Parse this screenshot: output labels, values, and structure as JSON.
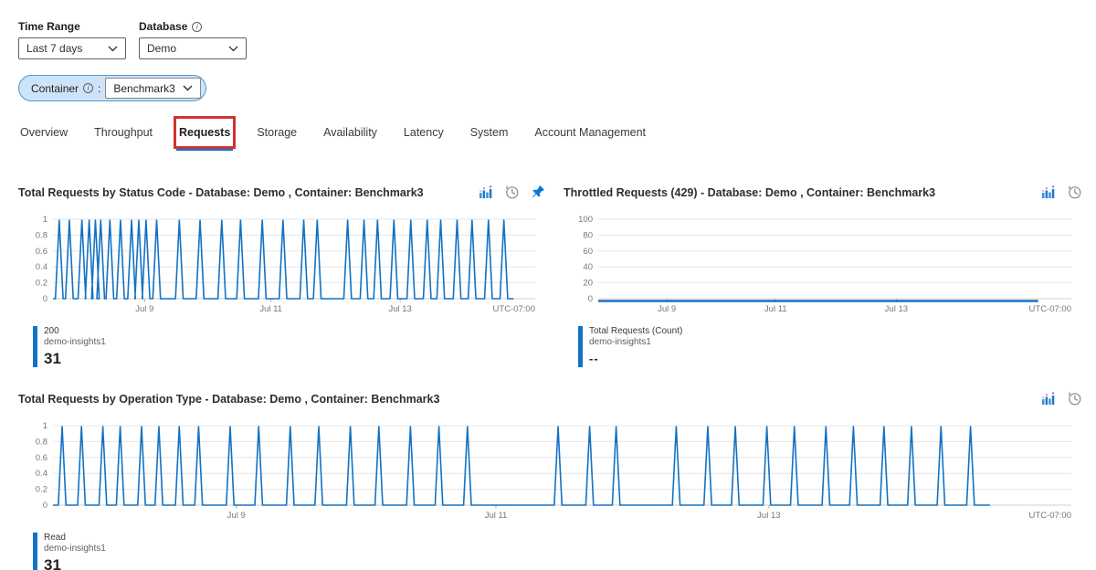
{
  "filters": {
    "time_range": {
      "label": "Time Range",
      "value": "Last 7 days"
    },
    "database": {
      "label": "Database",
      "value": "Demo"
    }
  },
  "container_filter": {
    "label": "Container",
    "separator": ":",
    "value": "Benchmark3"
  },
  "tabs": {
    "active": "Requests",
    "items": [
      {
        "label": "Overview"
      },
      {
        "label": "Throughput"
      },
      {
        "label": "Requests"
      },
      {
        "label": "Storage"
      },
      {
        "label": "Availability"
      },
      {
        "label": "Latency"
      },
      {
        "label": "System"
      },
      {
        "label": "Account Management"
      }
    ]
  },
  "colors": {
    "series_blue": "#1272c4",
    "grid": "#e5e5e5",
    "axis_line": "#d0cece",
    "axis_text": "#767676",
    "tab_underline": "#0b76d8",
    "annotation_red": "#cf352e"
  },
  "chart_data": [
    {
      "type": "line",
      "title": "Total Requests by Status Code - Database: Demo , Container: Benchmark3",
      "toolbar_icons": [
        "metrics-icon",
        "history-icon",
        "pin-icon"
      ],
      "ylim": [
        0,
        1
      ],
      "yticks": [
        0,
        0.2,
        0.4,
        0.6,
        0.8,
        1
      ],
      "xticks": [
        {
          "label": "Jul 9",
          "frac": 0.19
        },
        {
          "label": "Jul 11",
          "frac": 0.452
        },
        {
          "label": "Jul 13",
          "frac": 0.72
        },
        {
          "label": "UTC-07:00",
          "frac": 1,
          "anchor": "end"
        }
      ],
      "grid": true,
      "legend_position": "bottom",
      "series": [
        {
          "name": "200",
          "resource": "demo-insights1",
          "total": "31",
          "color": "#1272c4",
          "spike_value": 1,
          "line_end": 0.955,
          "spike_x": [
            0.013,
            0.034,
            0.06,
            0.075,
            0.088,
            0.099,
            0.118,
            0.14,
            0.163,
            0.178,
            0.193,
            0.215,
            0.262,
            0.305,
            0.35,
            0.389,
            0.434,
            0.477,
            0.52,
            0.548,
            0.611,
            0.645,
            0.673,
            0.707,
            0.742,
            0.776,
            0.804,
            0.838,
            0.869,
            0.903,
            0.935
          ]
        }
      ]
    },
    {
      "type": "line",
      "title": "Throttled Requests (429) - Database: Demo , Container: Benchmark3",
      "toolbar_icons": [
        "metrics-icon",
        "history-icon"
      ],
      "ylim": [
        0,
        100
      ],
      "yticks": [
        0,
        20,
        40,
        60,
        80,
        100
      ],
      "xticks": [
        {
          "label": "Jul 9",
          "frac": 0.145
        },
        {
          "label": "Jul 11",
          "frac": 0.375
        },
        {
          "label": "Jul 13",
          "frac": 0.63
        },
        {
          "label": "UTC-07:00",
          "frac": 1,
          "anchor": "end"
        }
      ],
      "grid": true,
      "legend_position": "bottom",
      "series": [
        {
          "name": "Total Requests (Count)",
          "resource": "demo-insights1",
          "total": "--",
          "color": "#1272c4",
          "flat_value": 0,
          "line_end": 0.93
        }
      ]
    },
    {
      "type": "line",
      "title": "Total Requests by Operation Type - Database: Demo , Container: Benchmark3",
      "toolbar_icons": [
        "metrics-icon",
        "history-icon"
      ],
      "ylim": [
        0,
        1
      ],
      "yticks": [
        0,
        0.2,
        0.4,
        0.6,
        0.8,
        1
      ],
      "xticks": [
        {
          "label": "Jul 9",
          "frac": 0.18
        },
        {
          "label": "Jul 11",
          "frac": 0.435
        },
        {
          "label": "Jul 13",
          "frac": 0.703
        },
        {
          "label": "UTC-07:00",
          "frac": 1,
          "anchor": "end"
        }
      ],
      "grid": true,
      "legend_position": "bottom",
      "series": [
        {
          "name": "Read",
          "resource": "demo-insights1",
          "total": "31",
          "color": "#1272c4",
          "spike_value": 1,
          "line_end": 0.92,
          "spike_x": [
            0.009,
            0.028,
            0.049,
            0.066,
            0.087,
            0.104,
            0.124,
            0.143,
            0.174,
            0.202,
            0.233,
            0.261,
            0.292,
            0.32,
            0.351,
            0.379,
            0.407,
            0.496,
            0.527,
            0.553,
            0.612,
            0.643,
            0.67,
            0.701,
            0.728,
            0.759,
            0.786,
            0.816,
            0.843,
            0.872,
            0.901
          ]
        }
      ]
    }
  ]
}
